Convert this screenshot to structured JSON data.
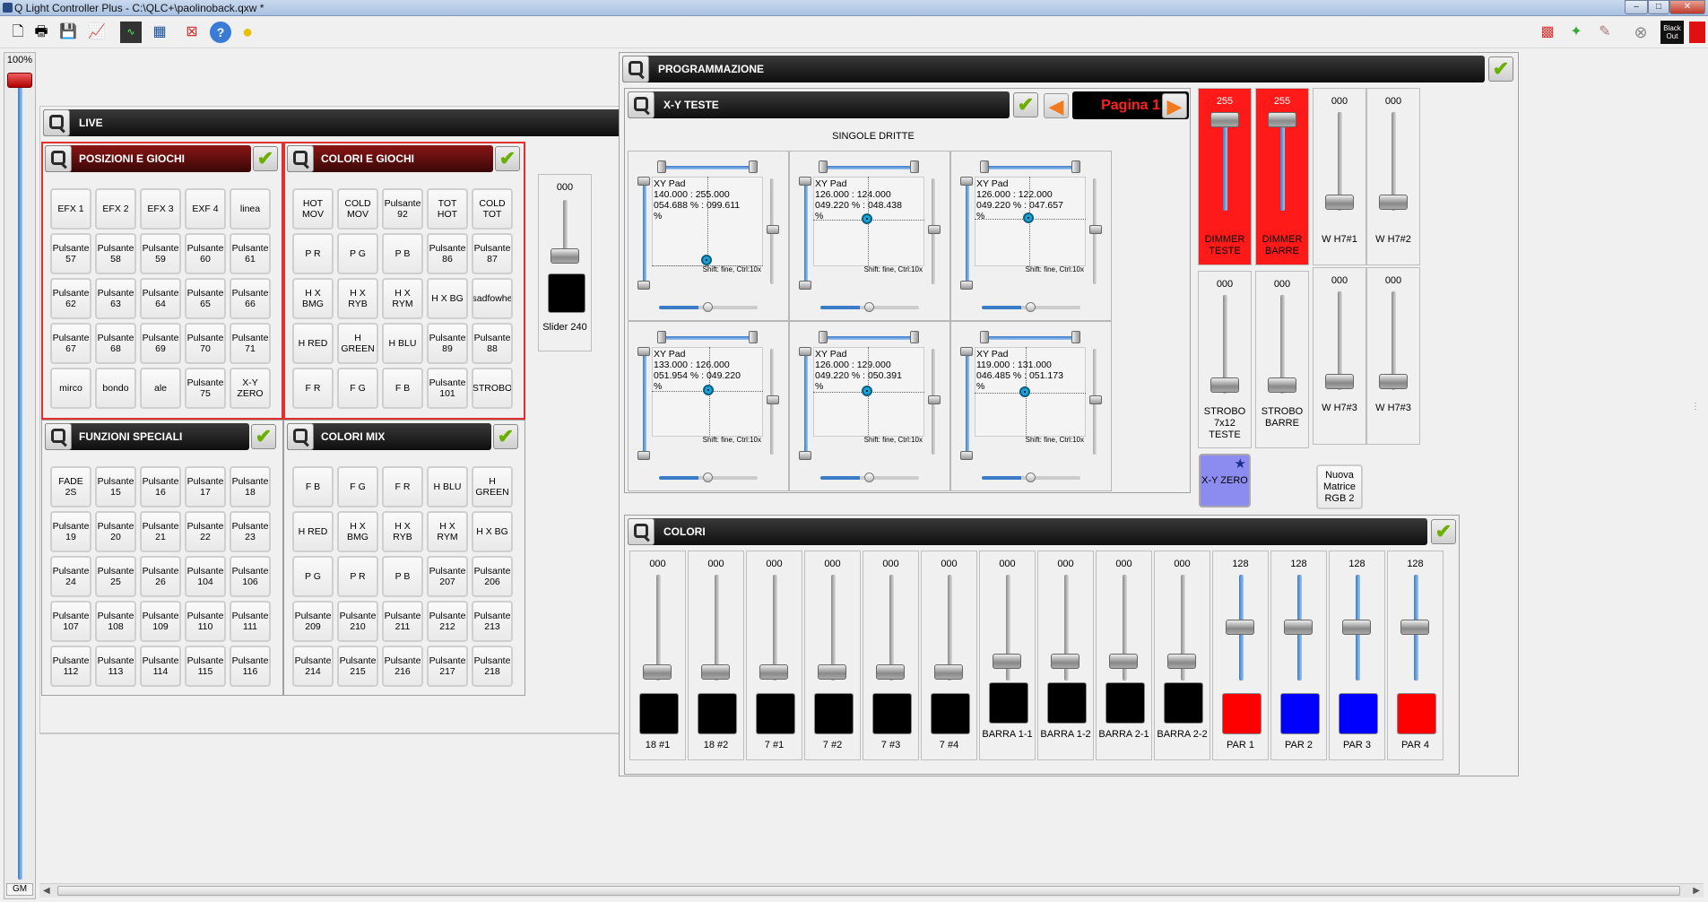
{
  "window": {
    "title": "Q Light Controller Plus - C:\\QLC+\\paolinoback.qxw *",
    "buttons": [
      "–",
      "□",
      "✕"
    ]
  },
  "toolbar": {
    "left_icons": [
      "new-file-icon",
      "print-icon",
      "save-icon",
      "chart-icon",
      "monitor-icon",
      "address-tool-icon",
      "dmx-dump-icon",
      "help-icon",
      "about-icon"
    ],
    "right_icons": [
      "rgb-matrix-icon",
      "wizard-icon",
      "pencil-icon",
      "close-icon"
    ],
    "blackout_label": "Black Out"
  },
  "grandmaster": {
    "value": "100%",
    "label": "GM"
  },
  "live": {
    "title": "LIVE"
  },
  "posizioni": {
    "title": "POSIZIONI E GIOCHI",
    "buttons": [
      "EFX 1",
      "EFX 2",
      "EFX 3",
      "EXF 4",
      "linea",
      "Pulsante 57",
      "Pulsante 58",
      "Pulsante 59",
      "Pulsante 60",
      "Pulsante 61",
      "Pulsante 62",
      "Pulsante 63",
      "Pulsante 64",
      "Pulsante 65",
      "Pulsante 66",
      "Pulsante 67",
      "Pulsante 68",
      "Pulsante 69",
      "Pulsante 70",
      "Pulsante 71",
      "mirco",
      "bondo",
      "ale",
      "Pulsante 75",
      "X-Y ZERO"
    ]
  },
  "colori_giochi": {
    "title": "COLORI E GIOCHI",
    "buttons": [
      "HOT MOV",
      "COLD MOV",
      "Pulsante 92",
      "TOT HOT",
      "COLD TOT",
      "P R",
      "P G",
      "P B",
      "Pulsante 86",
      "Pulsante 87",
      "H X BMG",
      "H X RYB",
      "H X RYM",
      "H X BG",
      "sadfowhe",
      "H RED",
      "H GREEN",
      "H BLU",
      "Pulsante 89",
      "Pulsante 88",
      "F R",
      "F G",
      "F B",
      "Pulsante 101",
      "STROBO"
    ]
  },
  "funzioni": {
    "title": "FUNZIONI SPECIALI",
    "buttons": [
      "FADE 2S",
      "Pulsante 15",
      "Pulsante 16",
      "Pulsante 17",
      "Pulsante 18",
      "Pulsante 19",
      "Pulsante 20",
      "Pulsante 21",
      "Pulsante 22",
      "Pulsante 23",
      "Pulsante 24",
      "Pulsante 25",
      "Pulsante 26",
      "Pulsante 104",
      "Pulsante 106",
      "Pulsante 107",
      "Pulsante 108",
      "Pulsante 109",
      "Pulsante 110",
      "Pulsante 111",
      "Pulsante 112",
      "Pulsante 113",
      "Pulsante 114",
      "Pulsante 115",
      "Pulsante 116"
    ]
  },
  "colori_mix": {
    "title": "COLORI MIX",
    "buttons": [
      "F B",
      "F G",
      "F R",
      "H BLU",
      "H GREEN",
      "H RED",
      "H X BMG",
      "H X RYB",
      "H X RYM",
      "H X BG",
      "P G",
      "P R",
      "P B",
      "Pulsante 207",
      "Pulsante 206",
      "Pulsante 209",
      "Pulsante 210",
      "Pulsante 211",
      "Pulsante 212",
      "Pulsante 213",
      "Pulsante 214",
      "Pulsante 215",
      "Pulsante 216",
      "Pulsante 217",
      "Pulsante 218"
    ]
  },
  "slider240": {
    "value": "000",
    "label": "Slider 240"
  },
  "programmazione": {
    "title": "PROGRAMMAZIONE"
  },
  "xyteste": {
    "title": "X-Y TESTE",
    "page_label": "Pagina 1",
    "subtitle": "SINGOLE DRITTE"
  },
  "xypads": [
    {
      "title": "XY Pad",
      "line1": "140.000 : 255.000",
      "line2": "054.688 % : 099.611",
      "line3": "%",
      "hint": "Shift: fine, Ctrl:10x",
      "fx": 0.5,
      "fy": 0.99
    },
    {
      "title": "XY Pad",
      "line1": "126.000 : 124.000",
      "line2": "049.220 % : 048.438",
      "line3": "%",
      "hint": "Shift: fine, Ctrl:10x",
      "fx": 0.49,
      "fy": 0.48
    },
    {
      "title": "XY Pad",
      "line1": "126.000 : 122.000",
      "line2": "049.220 % : 047.657",
      "line3": "%",
      "hint": "Shift: fine, Ctrl:10x",
      "fx": 0.49,
      "fy": 0.47
    },
    {
      "title": "XY Pad",
      "line1": "133.000 : 126.000",
      "line2": "051.954 % : 049.220",
      "line3": "%",
      "hint": "Shift: fine, Ctrl:10x",
      "fx": 0.52,
      "fy": 0.49
    },
    {
      "title": "XY Pad",
      "line1": "126.000 : 129.000",
      "line2": "049.220 % : 050.391",
      "line3": "%",
      "hint": "Shift: fine, Ctrl:10x",
      "fx": 0.49,
      "fy": 0.5
    },
    {
      "title": "XY Pad",
      "line1": "119.000 : 131.000",
      "line2": "046.485 % : 051.173",
      "line3": "%",
      "hint": "Shift: fine, Ctrl:10x",
      "fx": 0.46,
      "fy": 0.51
    }
  ],
  "dimmers": [
    {
      "value": "255",
      "label": "DIMMER TESTE",
      "color": "#ff1a1a",
      "level": 1.0
    },
    {
      "value": "255",
      "label": "DIMMER BARRE",
      "color": "#ff1a1a",
      "level": 1.0
    },
    {
      "value": "000",
      "label": "W H7#1",
      "color": "#f0f0f0",
      "level": 0
    },
    {
      "value": "000",
      "label": "W H7#2",
      "color": "#f0f0f0",
      "level": 0
    },
    {
      "value": "000",
      "label": "STROBO 7x12 TESTE",
      "color": "#f0f0f0",
      "level": 0
    },
    {
      "value": "000",
      "label": "STROBO BARRE",
      "color": "#f0f0f0",
      "level": 0
    },
    {
      "value": "000",
      "label": "W H7#3",
      "color": "#f0f0f0",
      "level": 0
    },
    {
      "value": "000",
      "label": "W H7#3",
      "color": "#f0f0f0",
      "level": 0
    }
  ],
  "xyzero": {
    "label": "X-Y ZERO",
    "color": "#8c8cf0"
  },
  "nuova_matrice": {
    "label": "Nuova Matrice RGB 2"
  },
  "colori": {
    "title": "COLORI",
    "sliders": [
      {
        "value": "000",
        "label": "18 #1",
        "swatch": "#000000",
        "level": 0
      },
      {
        "value": "000",
        "label": "18 #2",
        "swatch": "#000000",
        "level": 0
      },
      {
        "value": "000",
        "label": "7 #1",
        "swatch": "#000000",
        "level": 0
      },
      {
        "value": "000",
        "label": "7 #2",
        "swatch": "#000000",
        "level": 0
      },
      {
        "value": "000",
        "label": "7 #3",
        "swatch": "#000000",
        "level": 0
      },
      {
        "value": "000",
        "label": "7 #4",
        "swatch": "#000000",
        "level": 0
      },
      {
        "value": "000",
        "label": "BARRA 1-1",
        "swatch": "#000000",
        "level": 0
      },
      {
        "value": "000",
        "label": "BARRA 1-2",
        "swatch": "#000000",
        "level": 0
      },
      {
        "value": "000",
        "label": "BARRA 2-1",
        "swatch": "#000000",
        "level": 0
      },
      {
        "value": "000",
        "label": "BARRA 2-2",
        "swatch": "#000000",
        "level": 0
      },
      {
        "value": "128",
        "label": "PAR 1",
        "swatch": "#ff0000",
        "level": 0.5
      },
      {
        "value": "128",
        "label": "PAR 2",
        "swatch": "#0000ff",
        "level": 0.5
      },
      {
        "value": "128",
        "label": "PAR 3",
        "swatch": "#0000ff",
        "level": 0.5
      },
      {
        "value": "128",
        "label": "PAR 4",
        "swatch": "#ff0000",
        "level": 0.5
      }
    ]
  }
}
